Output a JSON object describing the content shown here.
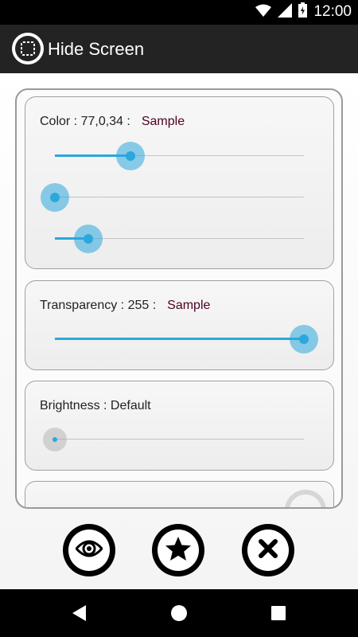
{
  "status_bar": {
    "time": "12:00"
  },
  "app": {
    "title": "Hide Screen"
  },
  "color_card": {
    "label": "Color : 77,0,34 :",
    "sample": "Sample",
    "red": 77,
    "green": 0,
    "blue": 34,
    "max": 255
  },
  "transparency_card": {
    "label": "Transparency : 255 :",
    "sample": "Sample",
    "value": 255,
    "max": 255
  },
  "brightness_card": {
    "label": "Brightness : Default",
    "value": 0
  },
  "buttons": {
    "show": "eye-icon",
    "favorite": "star-icon",
    "close": "close-icon"
  },
  "colors": {
    "accent": "#2ba7dc",
    "action_bar": "#232323"
  }
}
